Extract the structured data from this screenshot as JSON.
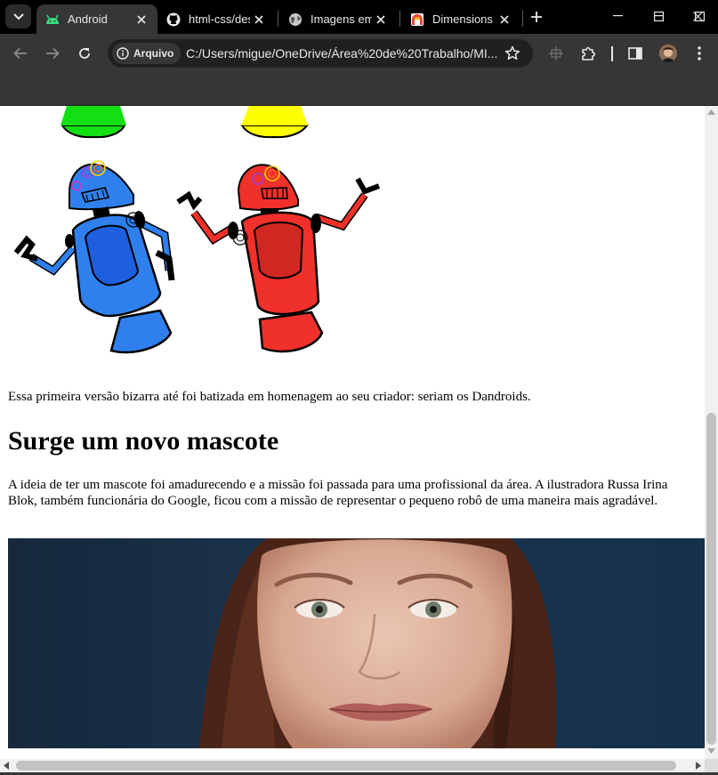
{
  "tabs": [
    {
      "title": "Android",
      "favicon": "android-icon",
      "active": true
    },
    {
      "title": "html-css/des",
      "favicon": "github-icon",
      "active": false
    },
    {
      "title": "Imagens em",
      "favicon": "globe-icon",
      "active": false
    },
    {
      "title": "Dimensions",
      "favicon": "dimensions-icon",
      "active": false
    }
  ],
  "toolbar": {
    "site_chip": "Arquivo",
    "url": "C:/Users/migue/OneDrive/Área%20de%20Trabalho/MI..."
  },
  "page": {
    "paragraph1": "Essa primeira versão bizarra até foi batizada em homenagem ao seu criador: seriam os Dandroids.",
    "heading": "Surge um novo mascote",
    "paragraph2": "A ideia de ter um mascote foi amadurecendo e a missão foi passada para uma profissional da área. A ilustradora Russa Irina Blok, também funcionária do Google, ficou com a missão de representar o pequeno robô de uma maneira mais agradável."
  },
  "colors": {
    "tabstrip_bg": "#000000",
    "toolbar_bg": "#363636",
    "omnibox_bg": "#202020",
    "android_green": "#3ddc84",
    "robot_blue": "#2f80ed",
    "robot_red": "#f0302a",
    "robot_green_top": "#12e012",
    "robot_yellow_top": "#ffff00"
  },
  "icons": {
    "tab_search": "chevron-down-icon",
    "back": "back-arrow-icon",
    "forward": "forward-arrow-icon",
    "reload": "reload-icon",
    "site_info": "info-icon",
    "bookmark": "star-icon",
    "cast": "cast-icon",
    "extensions": "puzzle-icon",
    "side_panel": "side-panel-icon",
    "menu": "kebab-menu-icon"
  }
}
